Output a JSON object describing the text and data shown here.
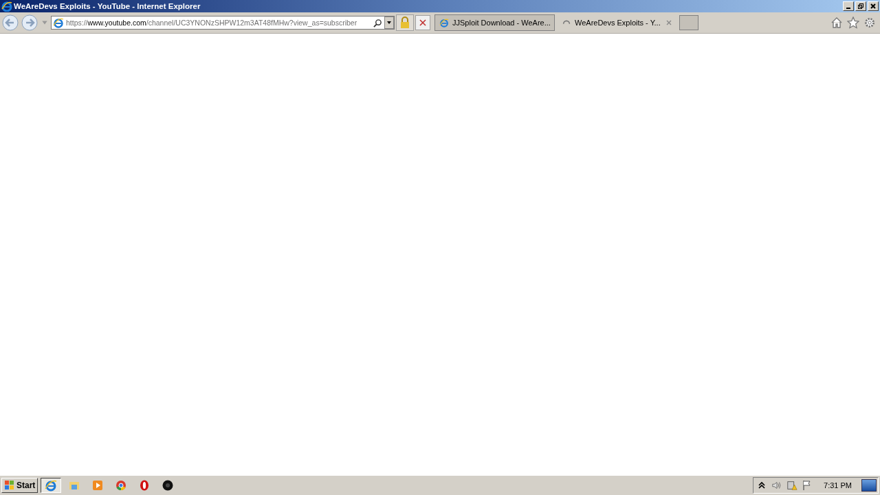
{
  "window": {
    "title": "WeAreDevs Exploits - YouTube - Internet Explorer"
  },
  "address_bar": {
    "scheme": "https://",
    "host": "www.youtube.com",
    "path": "/channel/UC3YNONzSHPW12m3AT48fMHw?view_as=subscriber"
  },
  "tabs": [
    {
      "label": "JJSploit Download - WeAre...",
      "selected": false,
      "kind": "ie"
    },
    {
      "label": "WeAreDevs Exploits - Y...",
      "selected": true,
      "kind": "loading"
    }
  ],
  "taskbar": {
    "start": "Start",
    "apps": [
      {
        "kind": "ie",
        "selected": true
      },
      {
        "kind": "folder",
        "selected": false
      },
      {
        "kind": "media",
        "selected": false
      },
      {
        "kind": "chrome",
        "selected": false
      },
      {
        "kind": "opera",
        "selected": false
      },
      {
        "kind": "dark",
        "selected": false
      }
    ],
    "clock": "7:31 PM"
  }
}
